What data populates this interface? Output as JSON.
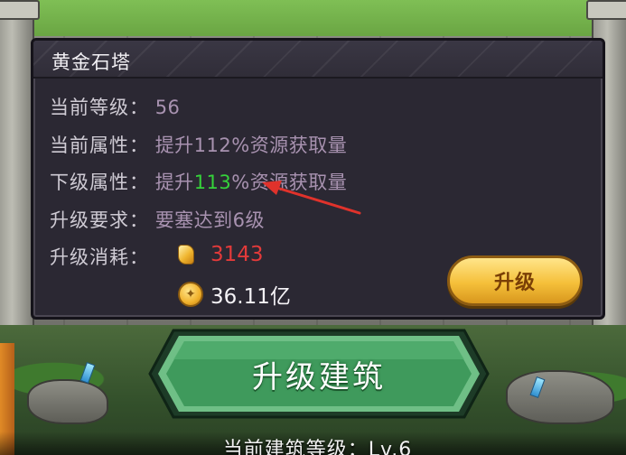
{
  "panel": {
    "title": "黄金石塔",
    "rows": [
      {
        "label": "当前等级：",
        "value": "56"
      },
      {
        "label": "当前属性：",
        "value": "提升112%资源获取量"
      },
      {
        "label": "下级属性：",
        "value_prefix": "提升",
        "value_highlight": "113",
        "value_suffix": "%资源获取量"
      },
      {
        "label": "升级要求：",
        "value": "要塞达到6级"
      },
      {
        "label": "升级消耗："
      }
    ],
    "costs": [
      {
        "icon": "gold-gem-icon",
        "amount": "3143"
      },
      {
        "icon": "gold-coin-icon",
        "amount": "36.11亿"
      }
    ],
    "upgrade_label": "升级"
  },
  "main_button": {
    "label": "升级建筑"
  },
  "footer": {
    "text": "当前建筑等级：Lv.6"
  },
  "colors": {
    "highlight_green": "#35d23a",
    "cost_red": "#e23a3a",
    "value_purple": "#a892b0",
    "annotation_arrow": "#e0322b"
  }
}
